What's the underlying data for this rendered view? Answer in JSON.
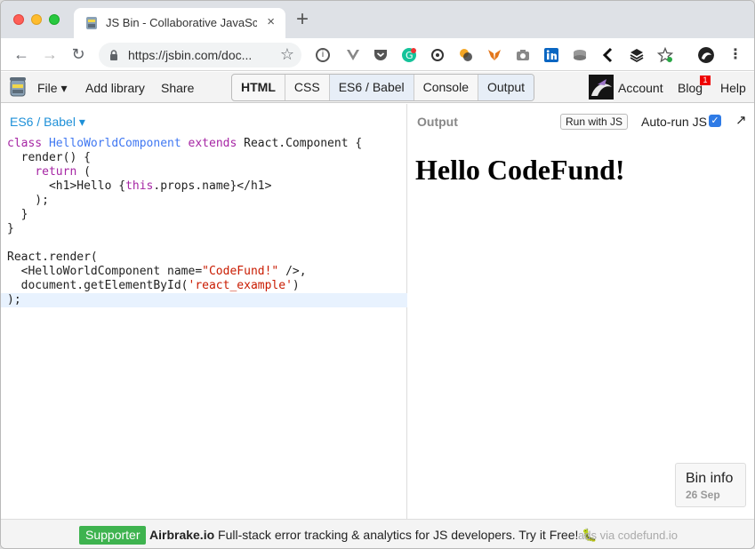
{
  "browser": {
    "tab_title": "JS Bin - Collaborative JavaScri",
    "tab_close": "×",
    "new_tab": "+",
    "url": "https://jsbin.com/doc...",
    "nav": {
      "back": "←",
      "forward": "→",
      "reload": "↻"
    },
    "star": "☆"
  },
  "jsbin": {
    "menus": {
      "file": "File ▾",
      "add_library": "Add library",
      "share": "Share"
    },
    "panels": [
      "HTML",
      "CSS",
      "ES6 / Babel",
      "Console",
      "Output"
    ],
    "account": "Account",
    "blog": "Blog",
    "blog_badge": "1",
    "help": "Help"
  },
  "editor": {
    "language": "ES6 / Babel ▾",
    "code_plain": {
      "l2": "  render() {",
      "l4a": "      <h1>Hello {",
      "l4b": ".props.name}</h1>",
      "l5": "    );",
      "l6": "  }",
      "l7": "}",
      "l9": "React.render(",
      "l10a": "  <HelloWorldComponent name=",
      "l10b": " />,",
      "l11a": "  document.getElementById(",
      "l11b": ")",
      "l12": ");"
    },
    "tokens": {
      "class": "class",
      "component": "HelloWorldComponent",
      "extends": "extends",
      "react_component": " React.Component {",
      "return": "return",
      "return_rest": " (",
      "this": "this",
      "name_str": "\"CodeFund!\"",
      "id_str": "'react_example'"
    }
  },
  "output": {
    "label": "Output",
    "run_button": "Run with JS",
    "autorun_label": "Auto-run JS",
    "autorun_checked": true,
    "heading": "Hello CodeFund!",
    "bin_info_title": "Bin info",
    "bin_info_date": "26 Sep"
  },
  "footer": {
    "badge": "Supporter",
    "sponsor": "Airbrake.io",
    "message": " Full-stack error tracking & analytics for JS developers. Try it Free! 🐛",
    "via": "ads via codefund.io"
  },
  "colors": {
    "supporter_green": "#3eb34f",
    "link_blue": "#1e90d8",
    "keyword": "#a626a4",
    "class_name": "#4078f2",
    "string": "#c91b00"
  }
}
